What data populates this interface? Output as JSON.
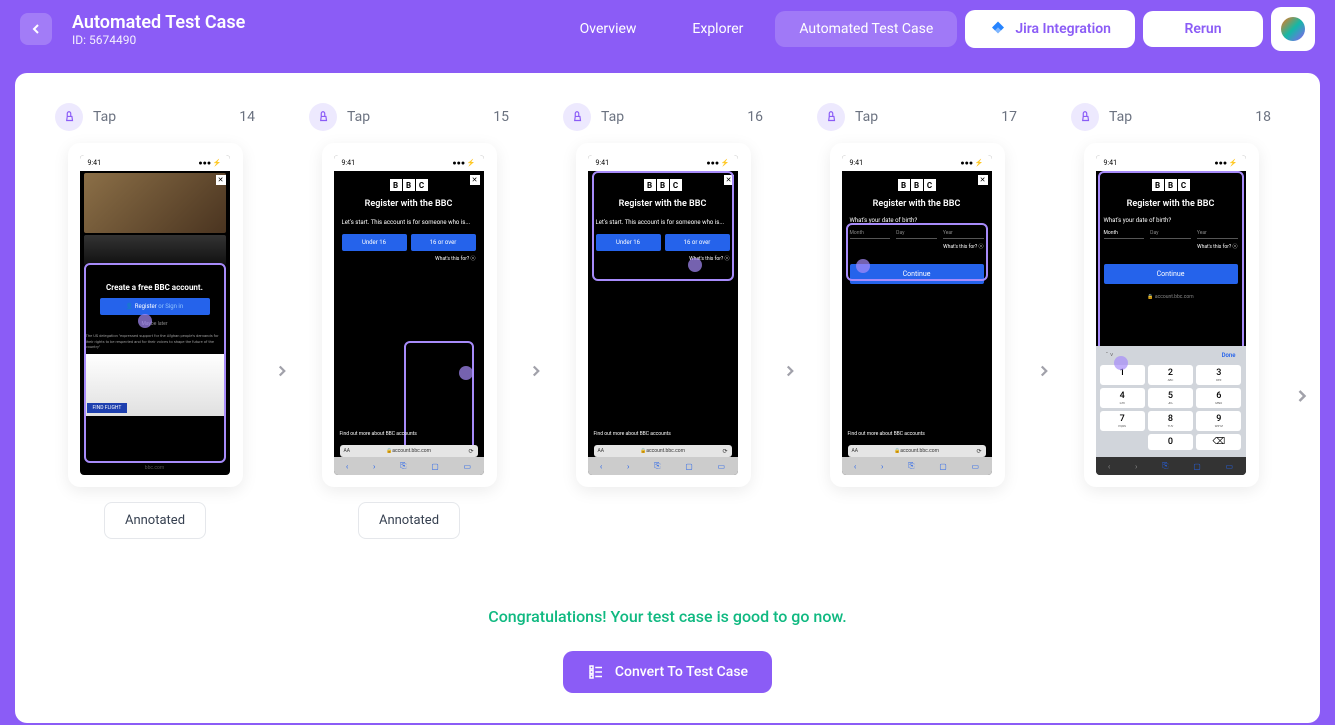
{
  "header": {
    "title": "Automated Test Case",
    "subtitle": "ID: 5674490",
    "tabs": [
      "Overview",
      "Explorer",
      "Automated Test Case"
    ],
    "active_tab": 2,
    "jira_label": "Jira Integration",
    "rerun_label": "Rerun"
  },
  "steps": [
    {
      "action": "Tap",
      "num": "14",
      "annotated": "Annotated",
      "type": "create_account"
    },
    {
      "action": "Tap",
      "num": "15",
      "annotated": "Annotated",
      "type": "register_age"
    },
    {
      "action": "Tap",
      "num": "16",
      "annotated": null,
      "type": "register_age_over"
    },
    {
      "action": "Tap",
      "num": "17",
      "annotated": null,
      "type": "dob"
    },
    {
      "action": "Tap",
      "num": "18",
      "annotated": null,
      "type": "dob_keypad"
    }
  ],
  "phone": {
    "time": "9:41",
    "bbc": [
      "B",
      "B",
      "C"
    ],
    "register_title": "Register with the BBC",
    "register_subtitle": "Let's start. This account is for someone who is...",
    "under16": "Under 16",
    "over16": "16 or over",
    "whats_this": "What's this for? ⓥ",
    "dob_question": "What's your date of birth?",
    "month": "Month",
    "day": "Day",
    "year": "Year",
    "continue": "Continue",
    "find_more": "Find out more about BBC accounts",
    "url": "account.bbc.com",
    "url_home": "bbc.com",
    "aa": "AA",
    "create_title": "Create a free BBC account.",
    "register_btn": "Register",
    "signin": "or Sign in",
    "maybe_later": "Maybe later",
    "find_flight": "FIND FLIGHT",
    "done": "Done",
    "keypad": [
      [
        {
          "n": "1",
          "s": ""
        },
        {
          "n": "2",
          "s": "ABC"
        },
        {
          "n": "3",
          "s": "DEF"
        }
      ],
      [
        {
          "n": "4",
          "s": "GHI"
        },
        {
          "n": "5",
          "s": "JKL"
        },
        {
          "n": "6",
          "s": "MNO"
        }
      ],
      [
        {
          "n": "7",
          "s": "PQRS"
        },
        {
          "n": "8",
          "s": "TUV"
        },
        {
          "n": "9",
          "s": "WXYZ"
        }
      ],
      [
        {
          "n": "",
          "s": "",
          "blank": true
        },
        {
          "n": "0",
          "s": ""
        },
        {
          "n": "⌫",
          "s": ""
        }
      ]
    ]
  },
  "footer": {
    "success": "Congratulations! Your test case is good to go now.",
    "convert": "Convert To Test Case"
  }
}
